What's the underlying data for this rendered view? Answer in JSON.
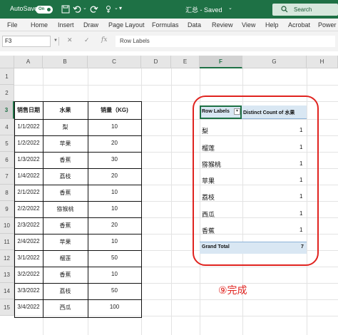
{
  "titlebar": {
    "autosave_label": "AutoSave",
    "autosave_state": "On",
    "doc_title": "汇总 - Saved",
    "search_placeholder": "Search"
  },
  "menu": [
    "File",
    "Home",
    "Insert",
    "Draw",
    "Page Layout",
    "Formulas",
    "Data",
    "Review",
    "View",
    "Help",
    "Acrobat",
    "Power"
  ],
  "formula_bar": {
    "name_box": "F3",
    "fx_label": "fx",
    "value": "Row Labels"
  },
  "columns": [
    "A",
    "B",
    "C",
    "D",
    "E",
    "F",
    "G",
    "H"
  ],
  "rows": [
    "1",
    "2",
    "3",
    "4",
    "5",
    "6",
    "7",
    "8",
    "9",
    "10",
    "11",
    "12",
    "13",
    "14",
    "15"
  ],
  "source_table": {
    "headers": [
      "销售日期",
      "水果",
      "销量（KG)"
    ],
    "rows": [
      [
        "1/1/2022",
        "梨",
        "10"
      ],
      [
        "1/2/2022",
        "苹果",
        "20"
      ],
      [
        "1/3/2022",
        "香蕉",
        "30"
      ],
      [
        "1/4/2022",
        "荔枝",
        "20"
      ],
      [
        "2/1/2022",
        "香蕉",
        "10"
      ],
      [
        "2/2/2022",
        "猕猴桃",
        "10"
      ],
      [
        "2/3/2022",
        "香蕉",
        "20"
      ],
      [
        "2/4/2022",
        "苹果",
        "10"
      ],
      [
        "3/1/2022",
        "榴莲",
        "50"
      ],
      [
        "3/2/2022",
        "香蕉",
        "10"
      ],
      [
        "3/3/2022",
        "荔枝",
        "50"
      ],
      [
        "3/4/2022",
        "西瓜",
        "100"
      ]
    ]
  },
  "pivot": {
    "row_labels_header": "Row Labels",
    "value_header": "Distinct Count of 水果",
    "items": [
      {
        "label": "梨",
        "count": "1"
      },
      {
        "label": "榴莲",
        "count": "1"
      },
      {
        "label": "猕猴桃",
        "count": "1"
      },
      {
        "label": "苹果",
        "count": "1"
      },
      {
        "label": "荔枝",
        "count": "1"
      },
      {
        "label": "西瓜",
        "count": "1"
      },
      {
        "label": "香蕉",
        "count": "1"
      }
    ],
    "grand_total_label": "Grand Total",
    "grand_total_value": "7"
  },
  "annotation": "⑨完成",
  "colors": {
    "excel_green": "#1e7145",
    "pivot_blue": "#d9e7f3",
    "highlight_red": "#e0231f"
  }
}
